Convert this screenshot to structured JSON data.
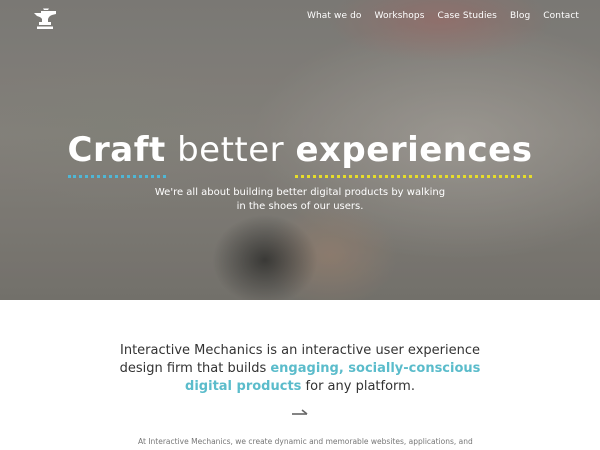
{
  "nav": {
    "items": [
      "What we do",
      "Workshops",
      "Case Studies",
      "Blog",
      "Contact"
    ]
  },
  "hero": {
    "headline_word1": "Craft",
    "headline_word2": "better",
    "headline_word3": "experiences",
    "tagline_line1": "We're all about building better digital products by walking",
    "tagline_line2": "in the shoes of our users."
  },
  "intro": {
    "line1": "Interactive Mechanics is an interactive user experience",
    "line2_plain": "design firm that builds ",
    "line2_highlight": "engaging, socially-conscious",
    "line3_highlight": "digital products",
    "line3_plain": " for any platform."
  },
  "body": {
    "text": "At Interactive Mechanics, we create dynamic and memorable websites, applications, and"
  },
  "colors": {
    "accent_blue": "#4fb7d6",
    "accent_yellow": "#e6dd2a",
    "highlight_teal": "#5bbccb"
  },
  "icons": {
    "logo": "anvil-icon",
    "scroll": "arrow-right-icon"
  }
}
